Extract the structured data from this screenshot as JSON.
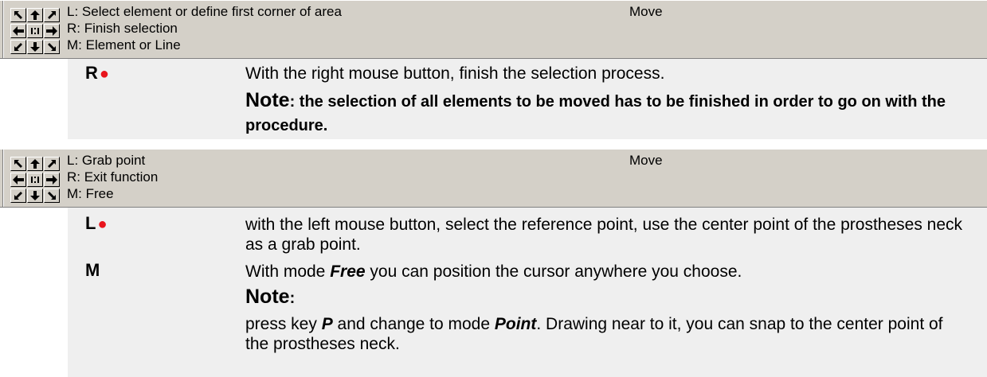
{
  "toolbar1": {
    "lines": [
      "L:  Select element or define first corner of area",
      "R:  Finish selection",
      "M: Element or Line"
    ],
    "title": "Move"
  },
  "section1": {
    "key": "R",
    "text": "With the right mouse button, finish the selection process.",
    "note_label": "Note",
    "note_text": ": the selection of all elements to be moved has to be finished in order to go on with the procedure."
  },
  "toolbar2": {
    "lines": [
      "L:  Grab point",
      "R:  Exit function",
      "M: Free"
    ],
    "title": "Move"
  },
  "section2": {
    "key": "L",
    "text": "with the left mouse button, select the reference point, use the center point of the prostheses neck as a grab point."
  },
  "section3": {
    "key": "M",
    "text_before": "With mode ",
    "mode_free": "Free",
    "text_after": " you can position the cursor anywhere you choose.",
    "note_label": "Note",
    "note_colon": ":",
    "press_before": "press key ",
    "key_p": "P",
    "press_mid": " and change to mode ",
    "mode_point": "Point",
    "press_after": ". Drawing near to it, you can snap to the center point of the prostheses neck."
  },
  "colors": {
    "toolbar_bg": "#d4d0c8",
    "bullet": "#e8141c",
    "section_bg": "#efefef"
  },
  "icons": [
    "arrow-up-left-icon",
    "arrow-up-icon",
    "arrow-up-right-icon",
    "arrow-left-icon",
    "center-icon",
    "arrow-right-icon",
    "arrow-down-left-icon",
    "arrow-down-icon",
    "arrow-down-right-icon"
  ]
}
